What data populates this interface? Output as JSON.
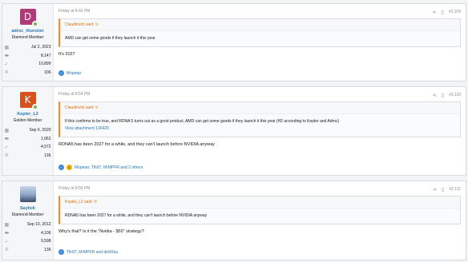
{
  "posts": [
    {
      "user": {
        "name": "adroc_thurston",
        "title": "Diamond Member",
        "avatar_letter": "D",
        "avatar_color": "#b03a78",
        "joined": "Jul 2, 2023",
        "messages": "8,147",
        "reactions": "10,899",
        "points": "106"
      },
      "time": "Friday at 8:46 PM",
      "number": "#2,109",
      "quote": {
        "author": "Claudiovict said:",
        "body": "AMD can get some goods if they launch it this year",
        "link": ""
      },
      "message": "It's 2027",
      "reactions": "Mopetar"
    },
    {
      "user": {
        "name": "Kepler_L2",
        "title": "Golden Member",
        "avatar_letter": "K",
        "avatar_color": "#d8501c",
        "joined": "Sep 6, 2020",
        "messages": "1,062",
        "reactions": "4,572",
        "points": "136"
      },
      "time": "Friday at 8:54 PM",
      "number": "#2,110",
      "quote": {
        "author": "Claudiovict said:",
        "body": "If this confirms to be true, and RDNA 5 turns out as a good product, AMD can get some goods if they launch it this year (H2 according to Kepler and Adroc)",
        "link": "View attachment 136429"
      },
      "message": "RDNA5 has been 2027 for a while, and they can't launch before NVIDIA anyway",
      "reactions": "Mopetar, Tlh97, MrMPFR and 2 others"
    },
    {
      "user": {
        "name": "Saylick",
        "title": "Diamond Member",
        "avatar_letter": "",
        "avatar_color": "#8aa3c7",
        "joined": "Sep 10, 2012",
        "messages": "4,106",
        "reactions": "9,598",
        "points": "136"
      },
      "time": "Friday at 8:56 PM",
      "number": "#2,111",
      "quote": {
        "author": "Kepler_L2 said:",
        "body": "RDNA5 has been 2027 for a while, and they can't launch before NVIDIA anyway",
        "link": ""
      },
      "message": "Why's that? Is it the \"Nvidia - $50\" strategy?",
      "reactions": "Tlh97, MrMPFR and del42sa"
    }
  ],
  "icons": {
    "calendar": "calendar-icon",
    "messages": "messages-icon",
    "reactions": "thumbs-up-icon",
    "points": "trophy-icon",
    "share": "share-icon",
    "bookmark": "bookmark-icon"
  }
}
